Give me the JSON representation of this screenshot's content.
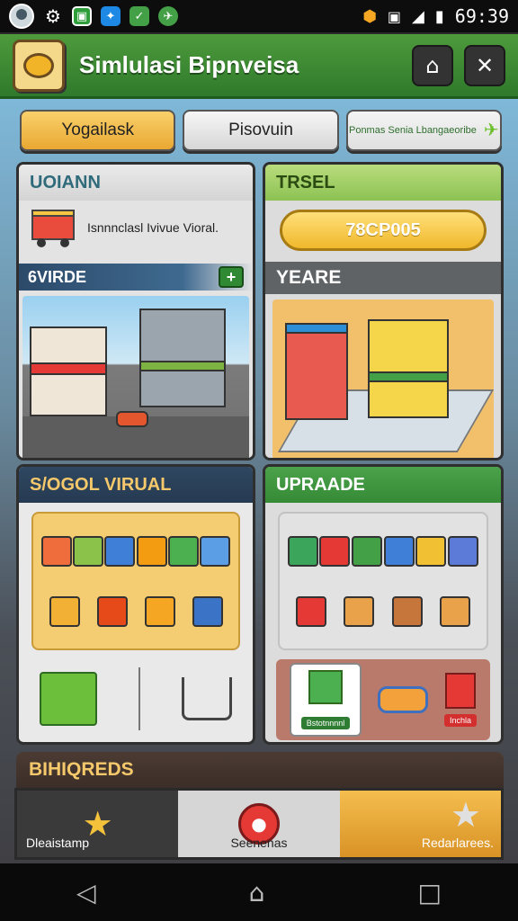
{
  "status_bar": {
    "time": "69:39",
    "left_icons": [
      "avatar-icon",
      "gear-icon",
      "app-icon-1",
      "app-icon-2",
      "app-icon-3",
      "app-icon-4"
    ],
    "right_icons": [
      "shield-icon",
      "notification-icon",
      "signal-icon",
      "battery-icon"
    ]
  },
  "header": {
    "title": "Simlulasi Bipnveisa",
    "buttons": [
      "home-icon",
      "close-icon"
    ]
  },
  "tabs": [
    {
      "label": "Yogailask"
    },
    {
      "label": "Pisovuin"
    },
    {
      "label": "Ponmas Senia Lbangaeoribe"
    }
  ],
  "panels": {
    "top_left": {
      "title": "UOIANN",
      "desc": "Isnnnclasl Ivivue Vioral.",
      "band": "6VIRDE"
    },
    "top_right": {
      "title": "TRSEL",
      "button": "78CP005",
      "band": "YEARE"
    },
    "bottom_left": {
      "title": "S/OGOL VIRUAL"
    },
    "bottom_right": {
      "title": "UPRAADE",
      "chips": [
        "Bstotnnnnl",
        "Inchla"
      ]
    }
  },
  "section_label": "BIHIQREDS",
  "bottom_tabs": [
    {
      "label": "Dleaistamp"
    },
    {
      "label": "Seenenas"
    },
    {
      "label": "Redarlarees."
    }
  ],
  "colors": {
    "header_green": "#3a8a33",
    "gold": "#f0b82b",
    "navy": "#2f4761"
  }
}
